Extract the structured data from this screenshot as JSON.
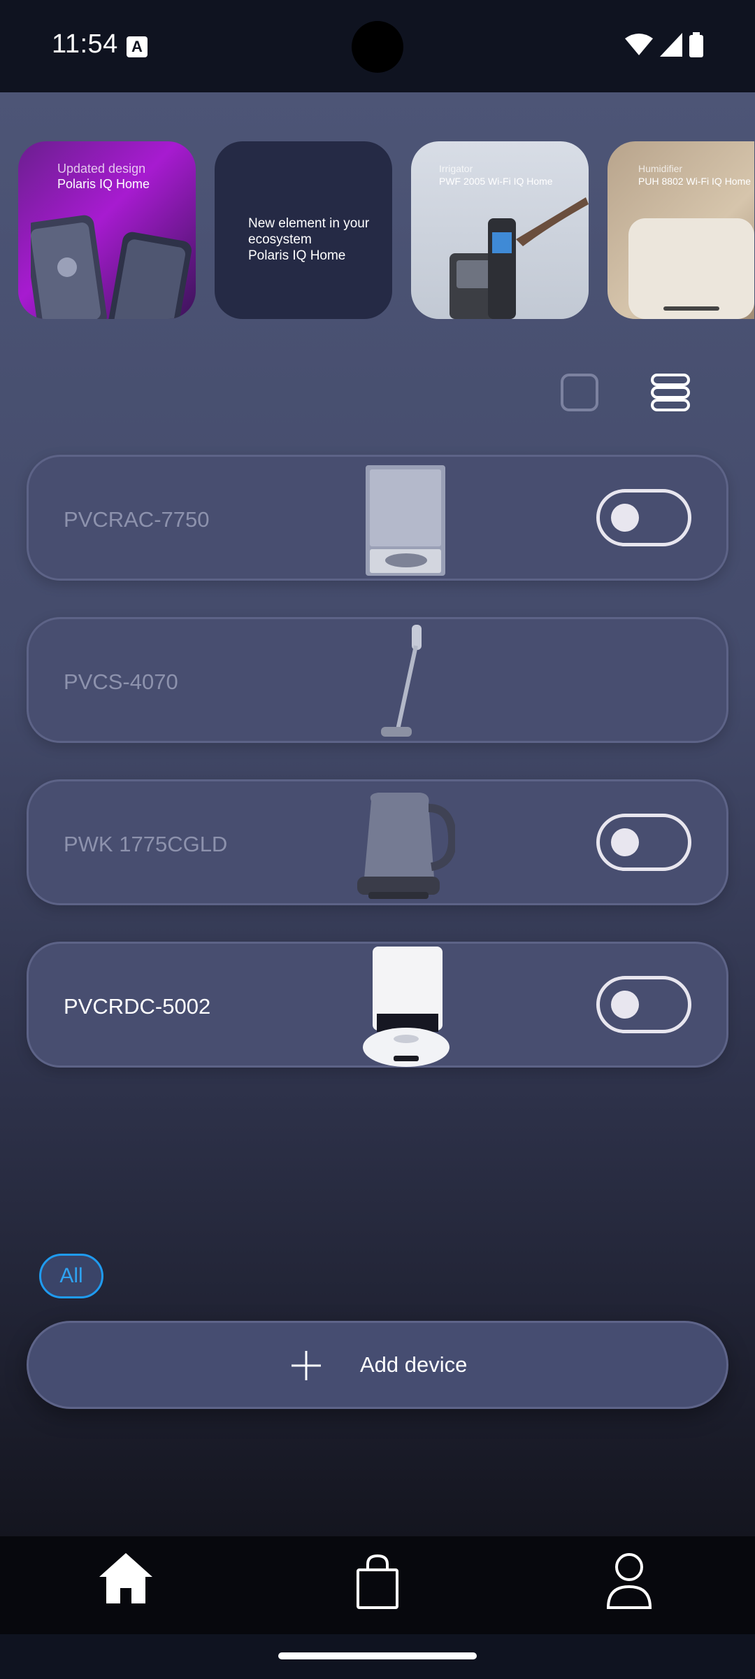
{
  "status_bar": {
    "time": "11:54",
    "notification_icon": "A"
  },
  "stories": [
    {
      "title": "Updated design",
      "subtitle": "Polaris IQ Home"
    },
    {
      "title": "New element in your ecosystem",
      "subtitle": "Polaris IQ Home"
    },
    {
      "title": "Irrigator",
      "subtitle": "PWF 2005 Wi-Fi IQ Home"
    },
    {
      "title": "Humidifier",
      "subtitle": "PUH 8802 Wi-Fi IQ Home"
    }
  ],
  "view_modes": {
    "grid_icon": "grid-icon",
    "list_icon": "list-icon"
  },
  "devices": [
    {
      "name": "PVCRAC-7750",
      "has_toggle": true,
      "toggle_on": false,
      "online": false,
      "icon": "robot-vacuum-station"
    },
    {
      "name": "PVCS-4070",
      "has_toggle": false,
      "online": false,
      "icon": "stick-vacuum"
    },
    {
      "name": "PWK 1775CGLD",
      "has_toggle": true,
      "toggle_on": false,
      "online": false,
      "icon": "kettle"
    },
    {
      "name": "PVCRDC-5002",
      "has_toggle": true,
      "toggle_on": false,
      "online": true,
      "icon": "robot-vacuum-dock"
    }
  ],
  "filter": {
    "label": "All"
  },
  "add_device": {
    "label": "Add device"
  },
  "nav": {
    "items": [
      "home-icon",
      "shopping-bag-icon",
      "profile-icon"
    ]
  },
  "colors": {
    "accent": "#1f9bf0",
    "card": "#484e70",
    "background": "#4d5576"
  }
}
